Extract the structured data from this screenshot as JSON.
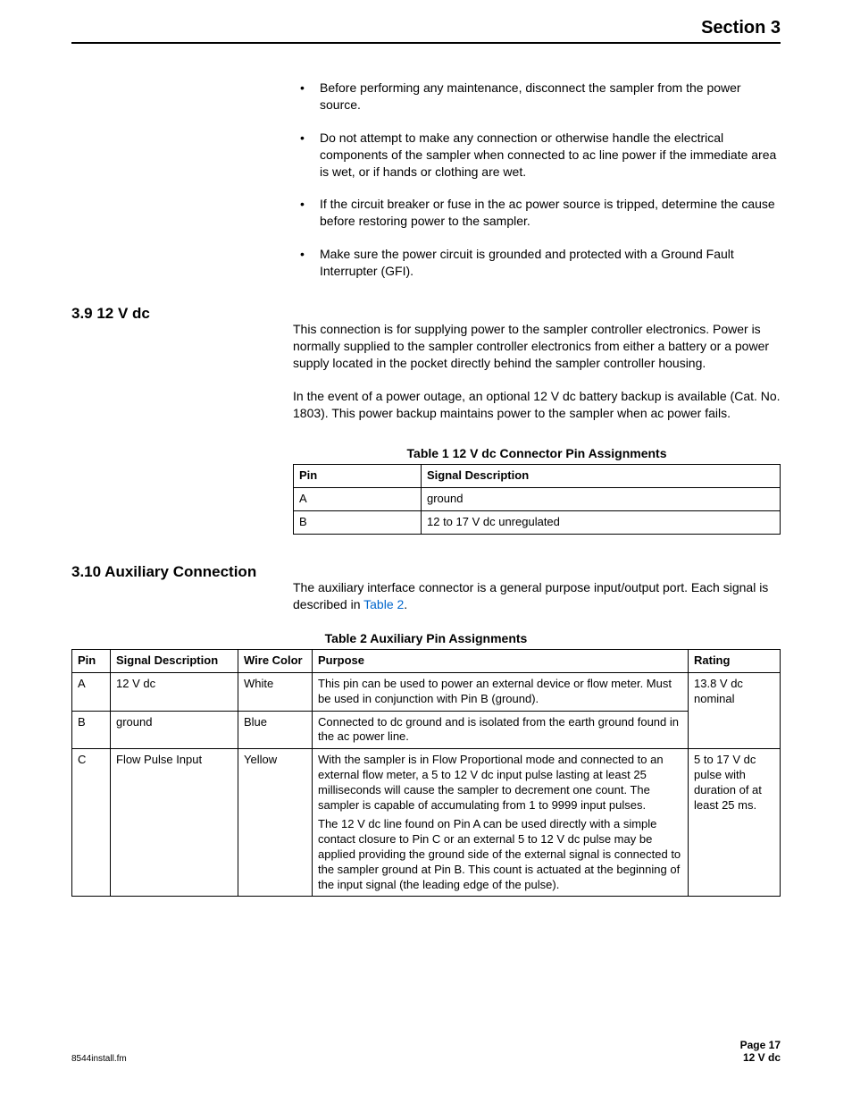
{
  "header": {
    "section_label": "Section 3"
  },
  "bullets": [
    "Before performing any maintenance, disconnect the sampler from the power source.",
    "Do not attempt to make any connection or otherwise handle the electrical components of the sampler when connected to ac line power if the immediate area is wet, or if hands or clothing are wet.",
    "If the circuit breaker or fuse in the ac power source is tripped, determine the cause before restoring power to the sampler.",
    "Make sure the power circuit is grounded and protected with a Ground Fault Interrupter (GFI)."
  ],
  "section39": {
    "heading": "3.9  12 V dc",
    "p1": "This connection is for supplying power to the sampler controller electronics. Power is normally supplied to the sampler controller electronics from either a battery or a power supply located in the pocket directly behind the sampler controller housing.",
    "p2": "In the event of a power outage, an optional 12 V dc battery backup is available (Cat. No. 1803). This power backup maintains power to the sampler when ac power fails."
  },
  "table1": {
    "caption": "Table 1 12 V dc Connector Pin Assignments",
    "headers": {
      "pin": "Pin",
      "signal": "Signal Description"
    },
    "rows": [
      {
        "pin": "A",
        "signal": "ground"
      },
      {
        "pin": "B",
        "signal": "12 to 17 V dc unregulated"
      }
    ]
  },
  "section310": {
    "heading": "3.10 Auxiliary Connection",
    "p1_pre": "The auxiliary interface connector is a general purpose input/output port. Each signal is described in ",
    "p1_link": "Table 2",
    "p1_post": "."
  },
  "table2": {
    "caption": "Table 2 Auxiliary Pin Assignments",
    "headers": {
      "pin": "Pin",
      "signal": "Signal Description",
      "wire": "Wire Color",
      "purpose": "Purpose",
      "rating": "Rating"
    },
    "rowA": {
      "pin": "A",
      "signal": "12 V dc",
      "wire": "White",
      "purpose": "This pin can be used to power an external device or flow meter. Must be used in conjunction with Pin B (ground)."
    },
    "rowB": {
      "pin": "B",
      "signal": "ground",
      "wire": "Blue",
      "purpose": "Connected to dc ground and is isolated from the earth ground found in the ac power line."
    },
    "ratingAB": "13.8 V dc nominal",
    "rowC": {
      "pin": "C",
      "signal": "Flow Pulse Input",
      "wire": "Yellow",
      "purpose1": "With the sampler is in Flow Proportional mode and connected to an external flow meter, a 5 to 12 V dc input pulse lasting at least 25 milliseconds will cause the sampler to decrement one count. The sampler is capable of accumulating from 1 to 9999 input pulses.",
      "purpose2": "The 12 V dc line found on Pin A can be used directly with a simple contact closure to Pin C or an external 5 to 12 V dc pulse may be applied providing the ground side of the external signal is connected to the sampler ground at Pin B. This count is actuated at the beginning of the input signal (the leading edge of the pulse).",
      "rating": "5 to 17 V dc pulse with duration of at least 25 ms."
    }
  },
  "footer": {
    "left": "8544install.fm",
    "page": "Page 17",
    "title": "12 V dc"
  }
}
